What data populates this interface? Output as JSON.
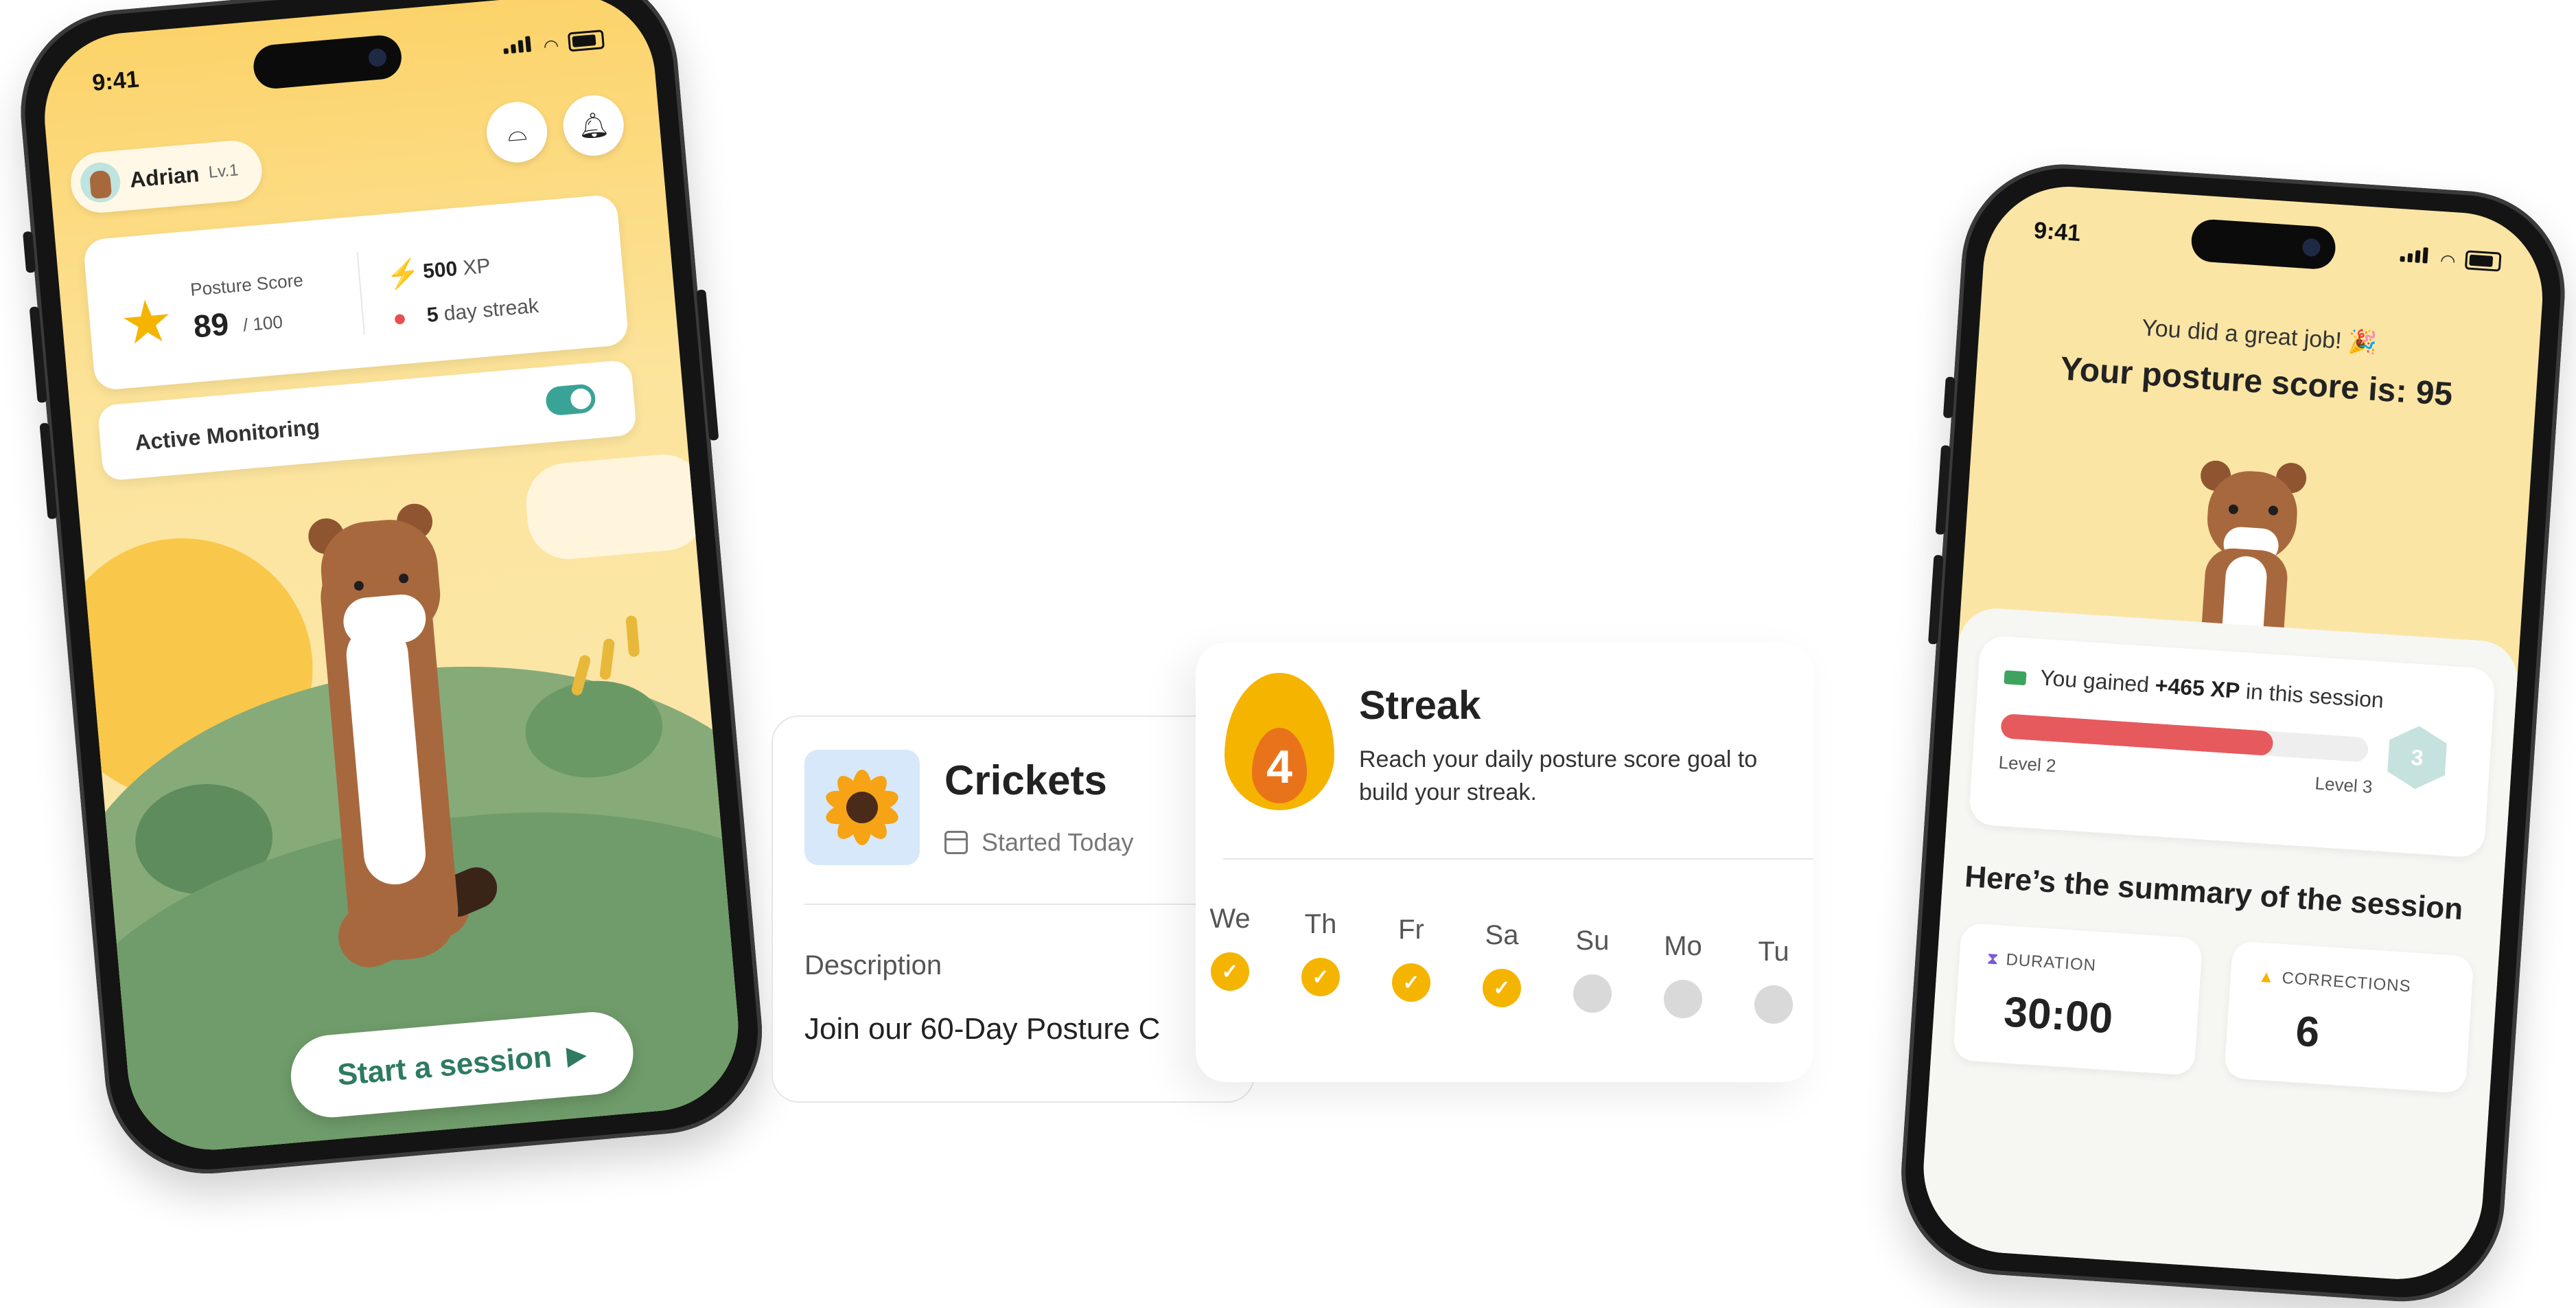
{
  "home": {
    "status_time": "9:41",
    "user": {
      "name": "Adrian",
      "level": "Lv.1"
    },
    "posture_score": {
      "label": "Posture Score",
      "value": "89",
      "max": "/ 100"
    },
    "xp": {
      "value": "500",
      "unit": "XP"
    },
    "streak": {
      "value": "5",
      "unit": "day streak"
    },
    "monitoring": {
      "label": "Active Monitoring",
      "enabled": true
    },
    "start_button": "Start a session"
  },
  "course": {
    "title": "Crickets",
    "started": "Started Today",
    "description_label": "Description",
    "description_text": "Join our 60-Day Posture C"
  },
  "streak_card": {
    "count": "4",
    "title": "Streak",
    "description": "Reach your daily posture score goal to build your streak.",
    "days": [
      {
        "label": "We",
        "done": true
      },
      {
        "label": "Th",
        "done": true
      },
      {
        "label": "Fr",
        "done": true
      },
      {
        "label": "Sa",
        "done": true
      },
      {
        "label": "Su",
        "done": false
      },
      {
        "label": "Mo",
        "done": false
      },
      {
        "label": "Tu",
        "done": false
      }
    ]
  },
  "result": {
    "status_time": "9:41",
    "great_job": "You did a great job! 🎉",
    "score_text": "Your posture score is: 95",
    "xp_gain_prefix": "You gained",
    "xp_gain_value": "+465 XP",
    "xp_gain_suffix": "in this session",
    "level_current": "Level 2",
    "level_next": "Level 3",
    "level_badge": "3",
    "level_progress": 0.74,
    "summary_title": "Here’s the summary of the session",
    "stats": [
      {
        "label": "DURATION",
        "value": "30:00",
        "icon": "hourglass-icon"
      },
      {
        "label": "CORRECTIONS",
        "value": "6",
        "icon": "warning-icon"
      }
    ]
  },
  "colors": {
    "accent_yellow": "#f5b400",
    "teal": "#3aa398",
    "green_button_text": "#2e7a62",
    "progress_red": "#e65a5d"
  }
}
